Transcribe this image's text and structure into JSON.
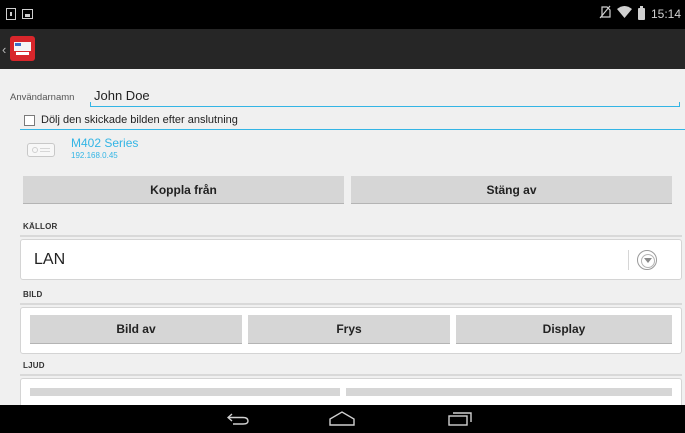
{
  "status_bar": {
    "time": "15:14",
    "icons": [
      "notification-icon",
      "screenshot-icon",
      "no-sim-icon",
      "wifi-icon",
      "battery-icon"
    ]
  },
  "action_bar": {
    "icons": [
      "back-caret-icon",
      "app-logo-icon"
    ],
    "app_color": "#d8262b"
  },
  "form": {
    "username_label": "Användarnamn",
    "username_value": "John Doe",
    "hide_checkbox_label": "Dölj den skickade bilden efter anslutning",
    "hide_checked": false
  },
  "device": {
    "name": "M402 Series",
    "ip": "192.168.0.45"
  },
  "actions": {
    "disconnect_label": "Koppla från",
    "power_off_label": "Stäng av"
  },
  "sources": {
    "header": "KÄLLOR",
    "selected": "LAN"
  },
  "image": {
    "header": "BILD",
    "buttons": [
      "Bild av",
      "Frys",
      "Display"
    ]
  },
  "audio": {
    "header": "LJUD"
  },
  "nav": {
    "icons": [
      "back-icon",
      "home-icon",
      "recent-apps-icon"
    ]
  },
  "colors": {
    "accent": "#33b5e5",
    "button_bg": "#d6d6d6",
    "action_bar_bg": "#262626"
  }
}
